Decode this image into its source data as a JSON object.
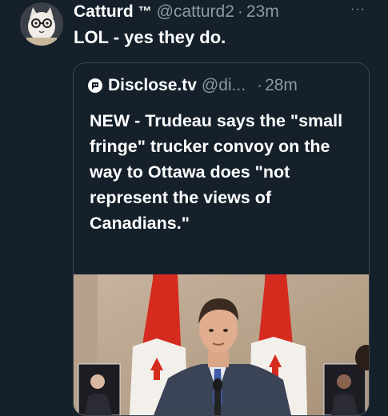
{
  "tweet": {
    "display_name": "Catturd",
    "tm": "™",
    "handle": "@catturd2",
    "separator": "·",
    "time": "23m",
    "more_label": "···",
    "text": "LOL - yes they do."
  },
  "quoted_tweet": {
    "display_name": "Disclose.tv",
    "handle": "@di...",
    "separator": "·",
    "time": "28m",
    "text": "NEW - Trudeau says the \"small fringe\" trucker convoy on the way to Ottawa does \"not represent the views of Canadians.\""
  },
  "colors": {
    "background": "#15202b",
    "secondary_text": "#8b98a5",
    "border": "#38444d",
    "flag_red": "#d52b1e"
  },
  "icons": {
    "avatar": "cat-avatar-icon",
    "quoted_avatar": "disclose-logo-icon"
  }
}
